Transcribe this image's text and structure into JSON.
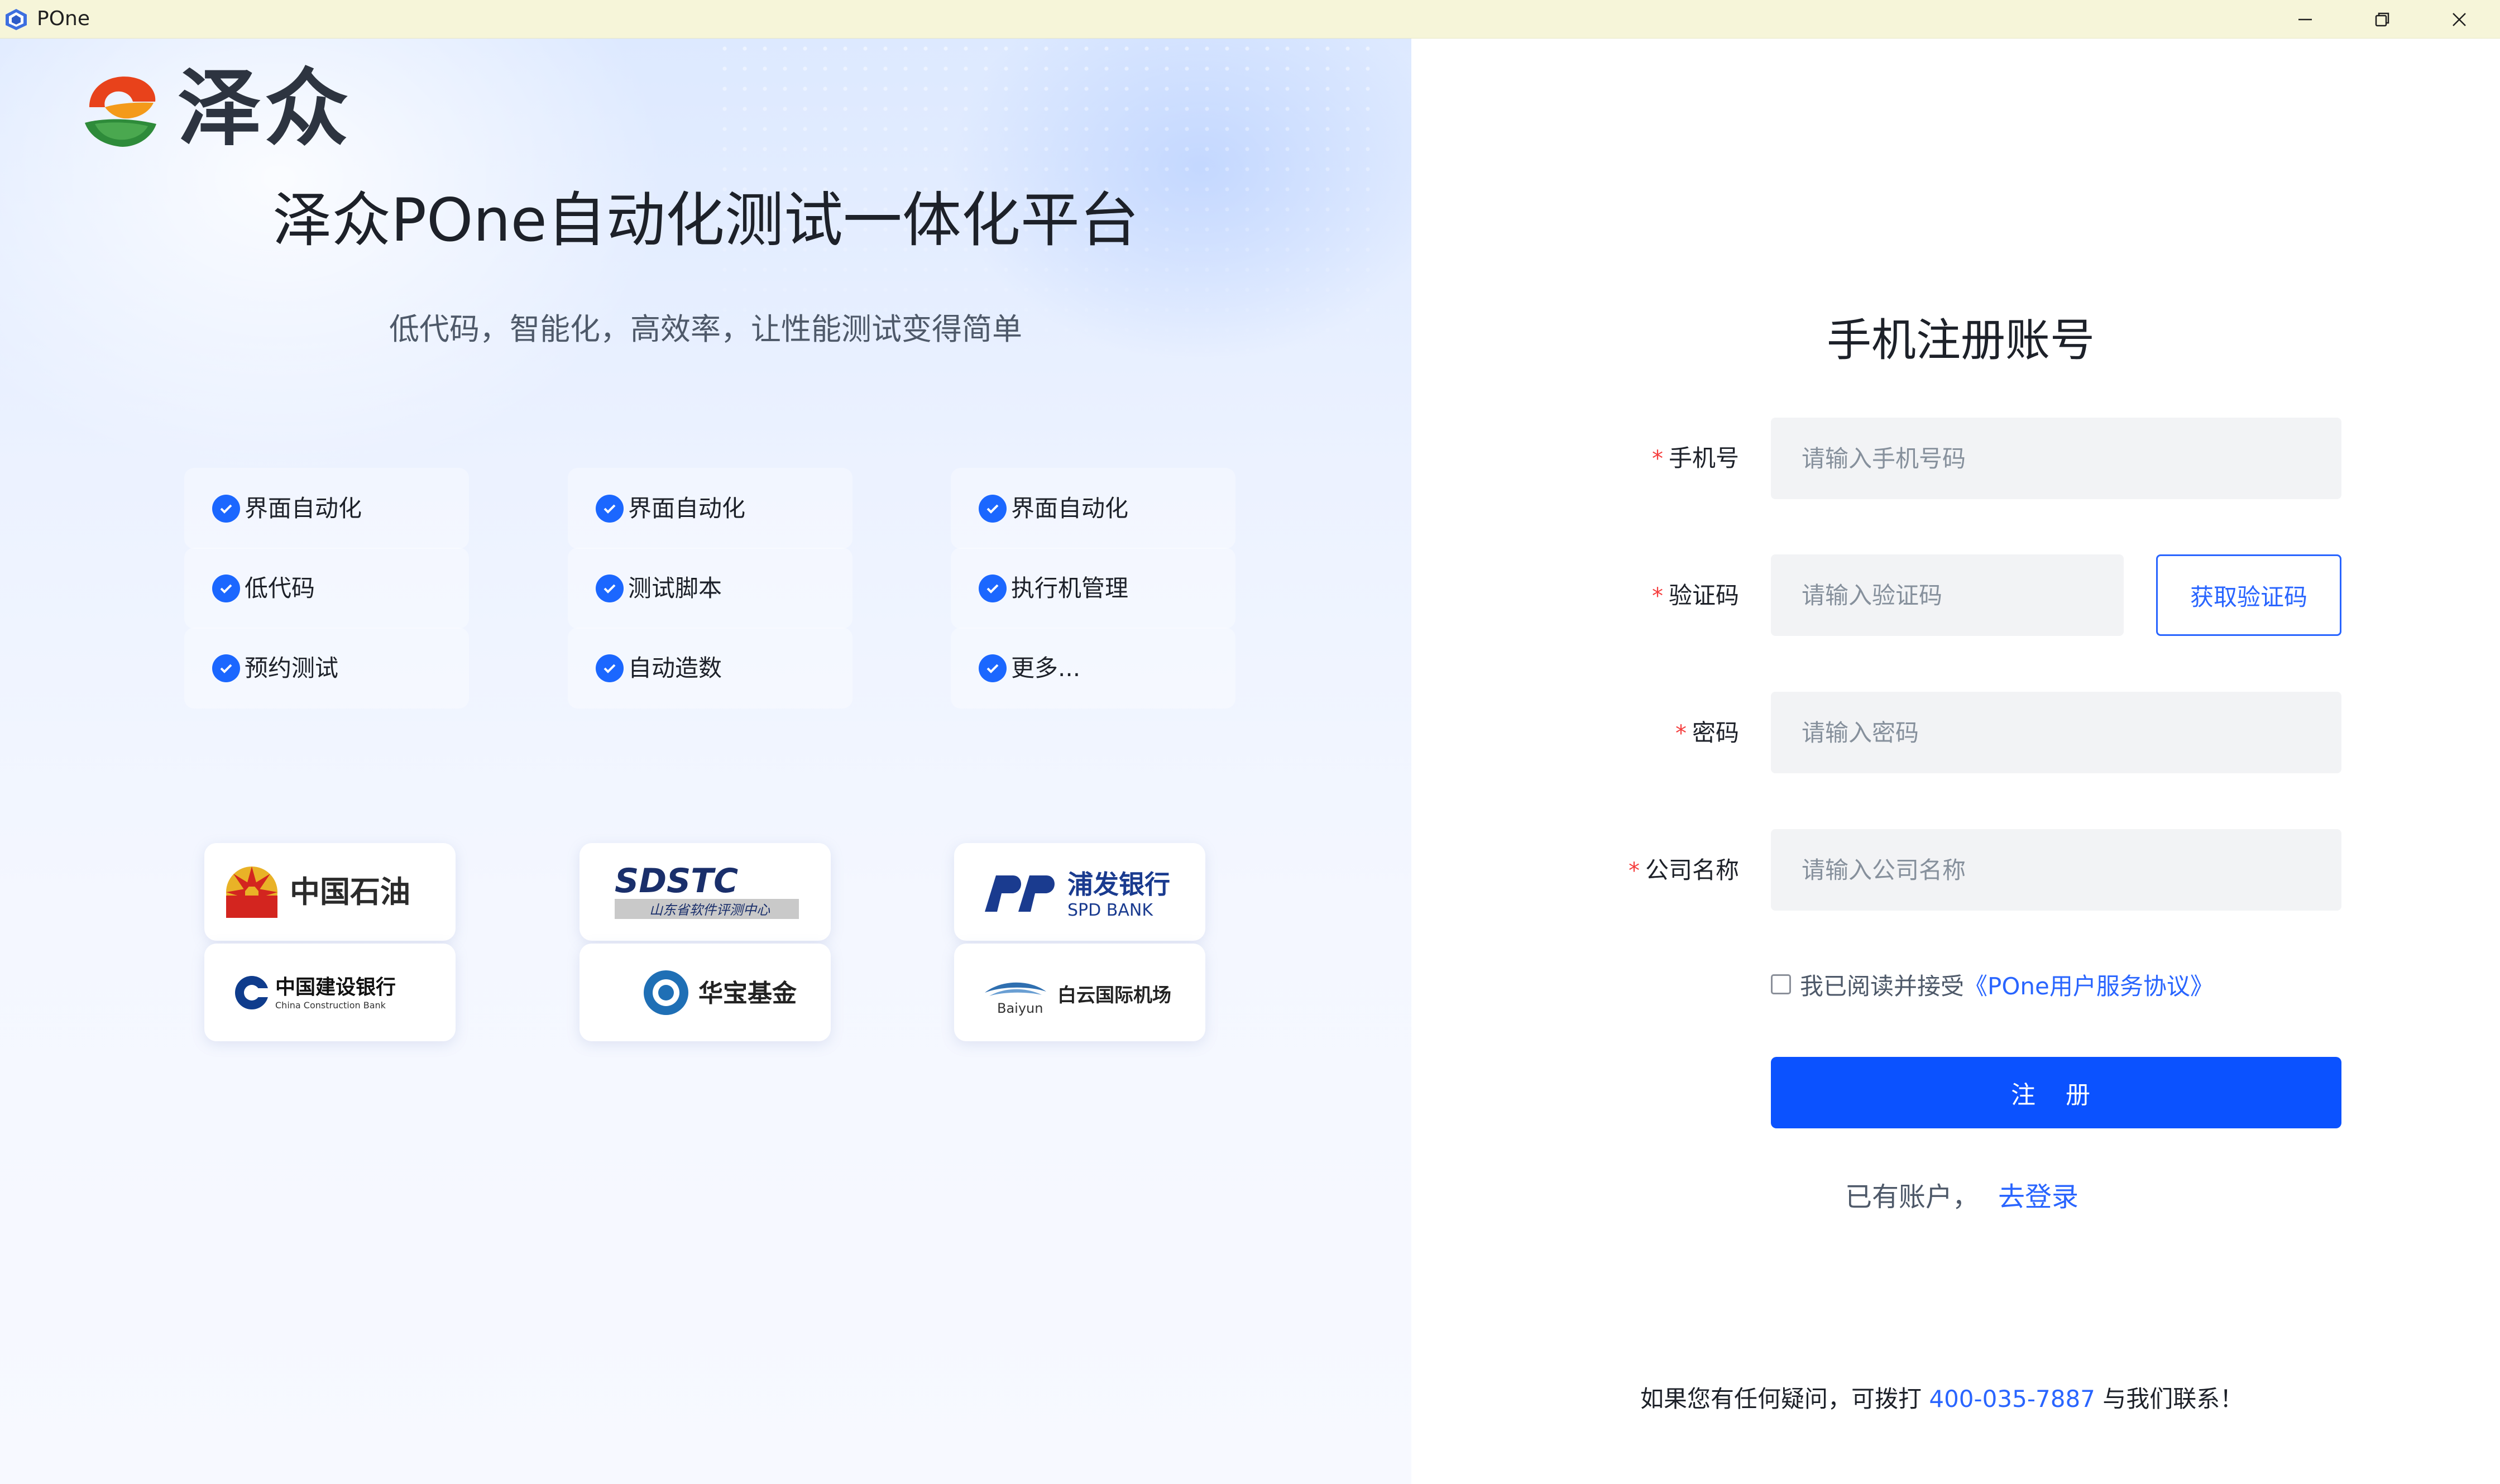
{
  "window": {
    "title": "POne",
    "controls": [
      "minimize",
      "restore",
      "close"
    ]
  },
  "brand": {
    "name": "泽众",
    "title": "泽众POne自动化测试一体化平台",
    "subtitle": "低代码，智能化，高效率，让性能测试变得简单"
  },
  "features": [
    {
      "label": "界面自动化"
    },
    {
      "label": "界面自动化"
    },
    {
      "label": "界面自动化"
    },
    {
      "label": "低代码"
    },
    {
      "label": "测试脚本"
    },
    {
      "label": "执行机管理"
    },
    {
      "label": "预约测试"
    },
    {
      "label": "自动造数"
    },
    {
      "label": "更多..."
    }
  ],
  "partners": [
    {
      "name": "中国石油"
    },
    {
      "name": "SDSTC",
      "sub": "山东省软件评测中心"
    },
    {
      "name": "浦发银行",
      "sub": "SPD BANK"
    },
    {
      "name": "中国建设银行",
      "sub": "China Construction Bank"
    },
    {
      "name": "华宝基金"
    },
    {
      "name": "白云国际机场",
      "sub": "Baiyun"
    }
  ],
  "form": {
    "title": "手机注册账号",
    "phone": {
      "label": "手机号",
      "placeholder": "请输入手机号码",
      "value": ""
    },
    "code": {
      "label": "验证码",
      "placeholder": "请输入验证码",
      "value": "",
      "button": "获取验证码"
    },
    "password": {
      "label": "密码",
      "placeholder": "请输入密码",
      "value": ""
    },
    "company": {
      "label": "公司名称",
      "placeholder": "请输入公司名称",
      "value": ""
    },
    "agreement": {
      "text": "我已阅读并接受",
      "link": "《POne用户服务协议》",
      "checked": false
    },
    "submit": "注 册",
    "login_prompt": "已有账户，",
    "login_link": "去登录"
  },
  "footer": {
    "prefix": "如果您有任何疑问，可拨打 ",
    "phone": "400-035-7887",
    "suffix": " 与我们联系！"
  },
  "colors": {
    "primary": "#0b52ff",
    "link": "#2965ff",
    "required": "#f53f3f",
    "titlebar": "#f6f5d9"
  }
}
